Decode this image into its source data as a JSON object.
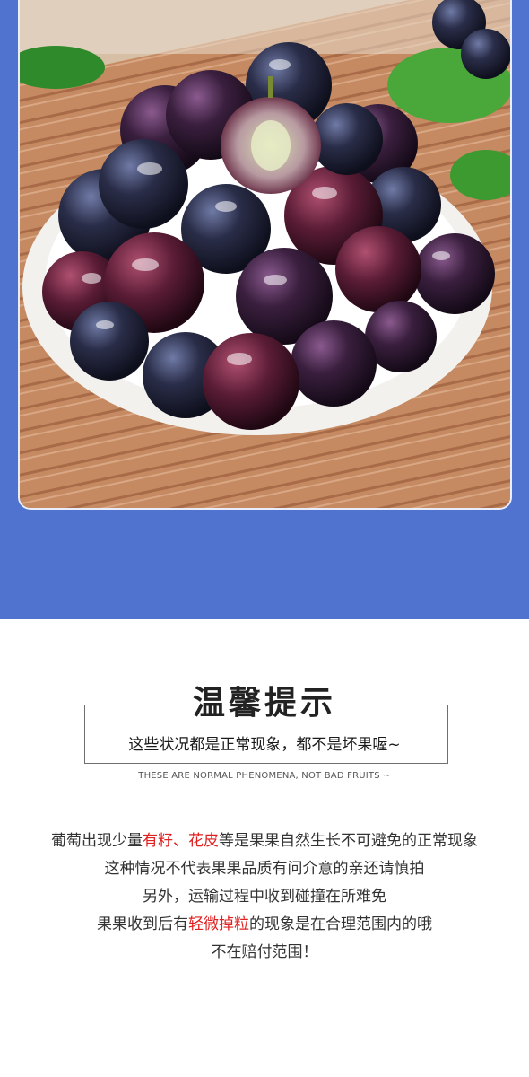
{
  "notice": {
    "title": "温馨提示",
    "subtitle": "这些状况都是正常现象，都不是坏果喔~",
    "english": "THESE ARE NORMAL PHENOMENA, NOT BAD FRUITS ~"
  },
  "paragraph": {
    "line1_a": "葡萄出现少量",
    "line1_red": "有籽、花皮",
    "line1_b": "等是果果自然生长不可避免的正常现象",
    "line2": "这种情况不代表果果品质有问介意的亲还请慎拍",
    "line3": "另外，运输过程中收到碰撞在所难免",
    "line4_a": "果果收到后有",
    "line4_red": "轻微掉粒",
    "line4_b": "的现象是在合理范围内的哦",
    "line5": "不在赔付范围！"
  },
  "colors": {
    "band": "#4f73cf",
    "highlight": "#e02020"
  }
}
